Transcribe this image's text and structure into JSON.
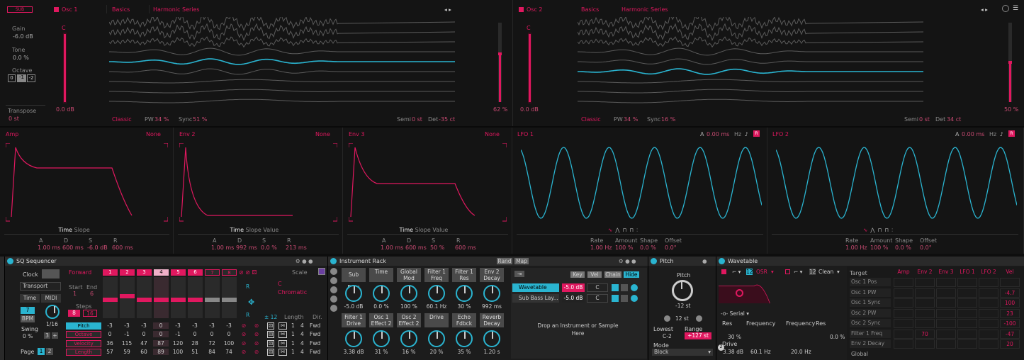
{
  "osc1": {
    "title": "Osc 1",
    "badge": "SUB",
    "category": "Basics",
    "wavetable": "Harmonic Series",
    "gain_label": "Gain",
    "gain": "-6.0 dB",
    "tone_label": "Tone",
    "tone": "0.0 %",
    "octave_label": "Octave",
    "octaves": [
      "0",
      "-1",
      "-2"
    ],
    "transpose_label": "Transpose",
    "transpose": "0 st",
    "meter_label": "C",
    "db": "0.0 dB",
    "mode": "Classic",
    "pw_label": "PW",
    "pw": "34 %",
    "sync_label": "Sync",
    "sync": "51 %",
    "semi_label": "Semi",
    "semi": "0 st",
    "det_label": "Det",
    "det": "-35 ct",
    "pos": "62 %"
  },
  "osc2": {
    "title": "Osc 2",
    "category": "Basics",
    "wavetable": "Harmonic Series",
    "meter_label": "C",
    "db": "0.0 dB",
    "mode": "Classic",
    "pw_label": "PW",
    "pw": "34 %",
    "sync_label": "Sync",
    "sync": "16 %",
    "semi_label": "Semi",
    "semi": "0 st",
    "det_label": "Det",
    "det": "34 ct",
    "pos": "50 %"
  },
  "envs": [
    {
      "name": "Amp",
      "mode": "None",
      "tabs": [
        "Time",
        "Slope"
      ],
      "labels": [
        "A",
        "D",
        "S",
        "R"
      ],
      "values": [
        "1.00 ms",
        "600 ms",
        "-6.0 dB",
        "600 ms"
      ]
    },
    {
      "name": "Env 2",
      "mode": "None",
      "tabs": [
        "Time",
        "Slope",
        "Value"
      ],
      "labels": [
        "A",
        "D",
        "S",
        "R"
      ],
      "values": [
        "1.00 ms",
        "992 ms",
        "0.0 %",
        "213 ms"
      ]
    },
    {
      "name": "Env 3",
      "mode": "None",
      "tabs": [
        "Time",
        "Slope",
        "Value"
      ],
      "labels": [
        "A",
        "D",
        "S",
        "R"
      ],
      "values": [
        "1.00 ms",
        "600 ms",
        "50 %",
        "600 ms"
      ]
    }
  ],
  "lfos": [
    {
      "name": "LFO 1",
      "a_label": "A",
      "a": "0.00 ms",
      "unit": "Hz",
      "labels": [
        "Rate",
        "Amount",
        "Shape",
        "Offset"
      ],
      "values": [
        "1.00 Hz",
        "100 %",
        "0.0 %",
        "0.0°"
      ]
    },
    {
      "name": "LFO 2",
      "a_label": "A",
      "a": "0.00 ms",
      "unit": "Hz",
      "labels": [
        "Rate",
        "Amount",
        "Shape",
        "Offset"
      ],
      "values": [
        "1.00 Hz",
        "100 %",
        "0.0 %",
        "0.0°"
      ]
    }
  ],
  "seq": {
    "title": "SQ Sequencer",
    "clock": "Clock",
    "transport": "Transport",
    "time": "Time",
    "midi": "MIDI",
    "bpm_val": "7",
    "bpm": "BPM",
    "rate": "1/16",
    "swing_label": "Swing",
    "swing": "0 %",
    "page_label": "Page",
    "pages": [
      "1",
      "2"
    ],
    "small": [
      "3",
      "+"
    ],
    "direction": "Forward",
    "steps_nums": [
      "1",
      "2",
      "3",
      "4",
      "5",
      "6",
      "7",
      "8"
    ],
    "start_label": "Start",
    "end_label": "End",
    "start": "1",
    "end": "6",
    "steps_label": "Steps",
    "steps_a": "8",
    "steps_b": "16",
    "scale_label": "Scale",
    "key": "C",
    "scale": "Chromatic",
    "length_label": "Length",
    "dir_label": "Dir.",
    "r1": "R",
    "r2": "R",
    "pm": "± 12",
    "rows": [
      {
        "name": "Pitch",
        "vals": [
          "-3",
          "-3",
          "-3",
          "0",
          "-3",
          "-3",
          "-3",
          "-3"
        ],
        "len": "1",
        "dir": "4",
        "fwd": "Fwd"
      },
      {
        "name": "Octave",
        "vals": [
          "0",
          "-1",
          "0",
          "0",
          "-1",
          "0",
          "0",
          "0"
        ],
        "len": "1",
        "dir": "4",
        "fwd": "Fwd"
      },
      {
        "name": "Velocity",
        "vals": [
          "36",
          "115",
          "47",
          "87",
          "120",
          "28",
          "72",
          "100"
        ],
        "len": "1",
        "dir": "4",
        "fwd": "Fwd"
      },
      {
        "name": "Length",
        "vals": [
          "57",
          "59",
          "60",
          "89",
          "100",
          "51",
          "84",
          "74"
        ],
        "len": "1",
        "dir": "4",
        "fwd": "Fwd"
      }
    ]
  },
  "rack": {
    "title": "Instrument Rack",
    "rand": "Rand",
    "map": "Map",
    "macros": [
      {
        "name": "Sub Bass",
        "val": "-5.0 dB"
      },
      {
        "name": "Time",
        "val": "0.0 %"
      },
      {
        "name": "Global Mod",
        "val": "100 %"
      },
      {
        "name": "Filter 1 Freq",
        "val": "60.1 Hz"
      },
      {
        "name": "Filter 1 Res",
        "val": "30 %"
      },
      {
        "name": "Env 2 Decay",
        "val": "992 ms"
      },
      {
        "name": "Filter 1 Drive",
        "val": "3.38 dB"
      },
      {
        "name": "Osc 1 Effect 2",
        "val": "31 %"
      },
      {
        "name": "Osc 2 Effect 2",
        "val": "16 %"
      },
      {
        "name": "Drive",
        "val": "20 %"
      },
      {
        "name": "Echo Fdbck",
        "val": "35 %"
      },
      {
        "name": "Reverb Decay",
        "val": "1.20 s"
      }
    ],
    "key": "Key",
    "vel": "Vel",
    "chain": "Chain",
    "hide": "Hide",
    "chains": [
      {
        "name": "Wavetable",
        "vol": "-5.0 dB",
        "pan": "C"
      },
      {
        "name": "Sub Bass Lay...",
        "vol": "-5.0 dB",
        "pan": "C"
      }
    ],
    "drop": "Drop an Instrument or Sample Here"
  },
  "pitch": {
    "title": "Pitch",
    "label": "Pitch",
    "val": "-12 st",
    "range_val": "12 st",
    "lowest_label": "Lowest",
    "lowest": "C-2",
    "range_label": "Range",
    "range": "+127 st",
    "mode_label": "Mode",
    "mode": "Block"
  },
  "wave": {
    "title": "Wavetable",
    "num1": "12",
    "osr": "OSR",
    "num2": "12",
    "clean": "Clean",
    "serial": "Serial",
    "res_label": "Res",
    "res": "30 %",
    "freq_label": "Frequency",
    "drive_label": "Drive",
    "drive": "3.38 dB",
    "freq": "60.1 Hz",
    "freq2_label": "Frequency",
    "res2_label": "Res",
    "freq2": "20.0 Hz",
    "res2": "0.0 %",
    "badge": "2",
    "target": "Target",
    "cols": [
      "Amp",
      "Env 2",
      "Env 3",
      "LFO 1",
      "LFO 2",
      "Vel"
    ],
    "targets": [
      "Osc 1 Pos",
      "Osc 1 PW",
      "Osc 1 Sync",
      "Osc 2 PW",
      "Osc 2 Sync",
      "Filter 1 Freq",
      "Env 2 Decay",
      "Global"
    ],
    "vel_vals": [
      "",
      "-4.7",
      "100",
      "23",
      "-100",
      "-47",
      "20",
      ""
    ],
    "env2_val": "70"
  }
}
